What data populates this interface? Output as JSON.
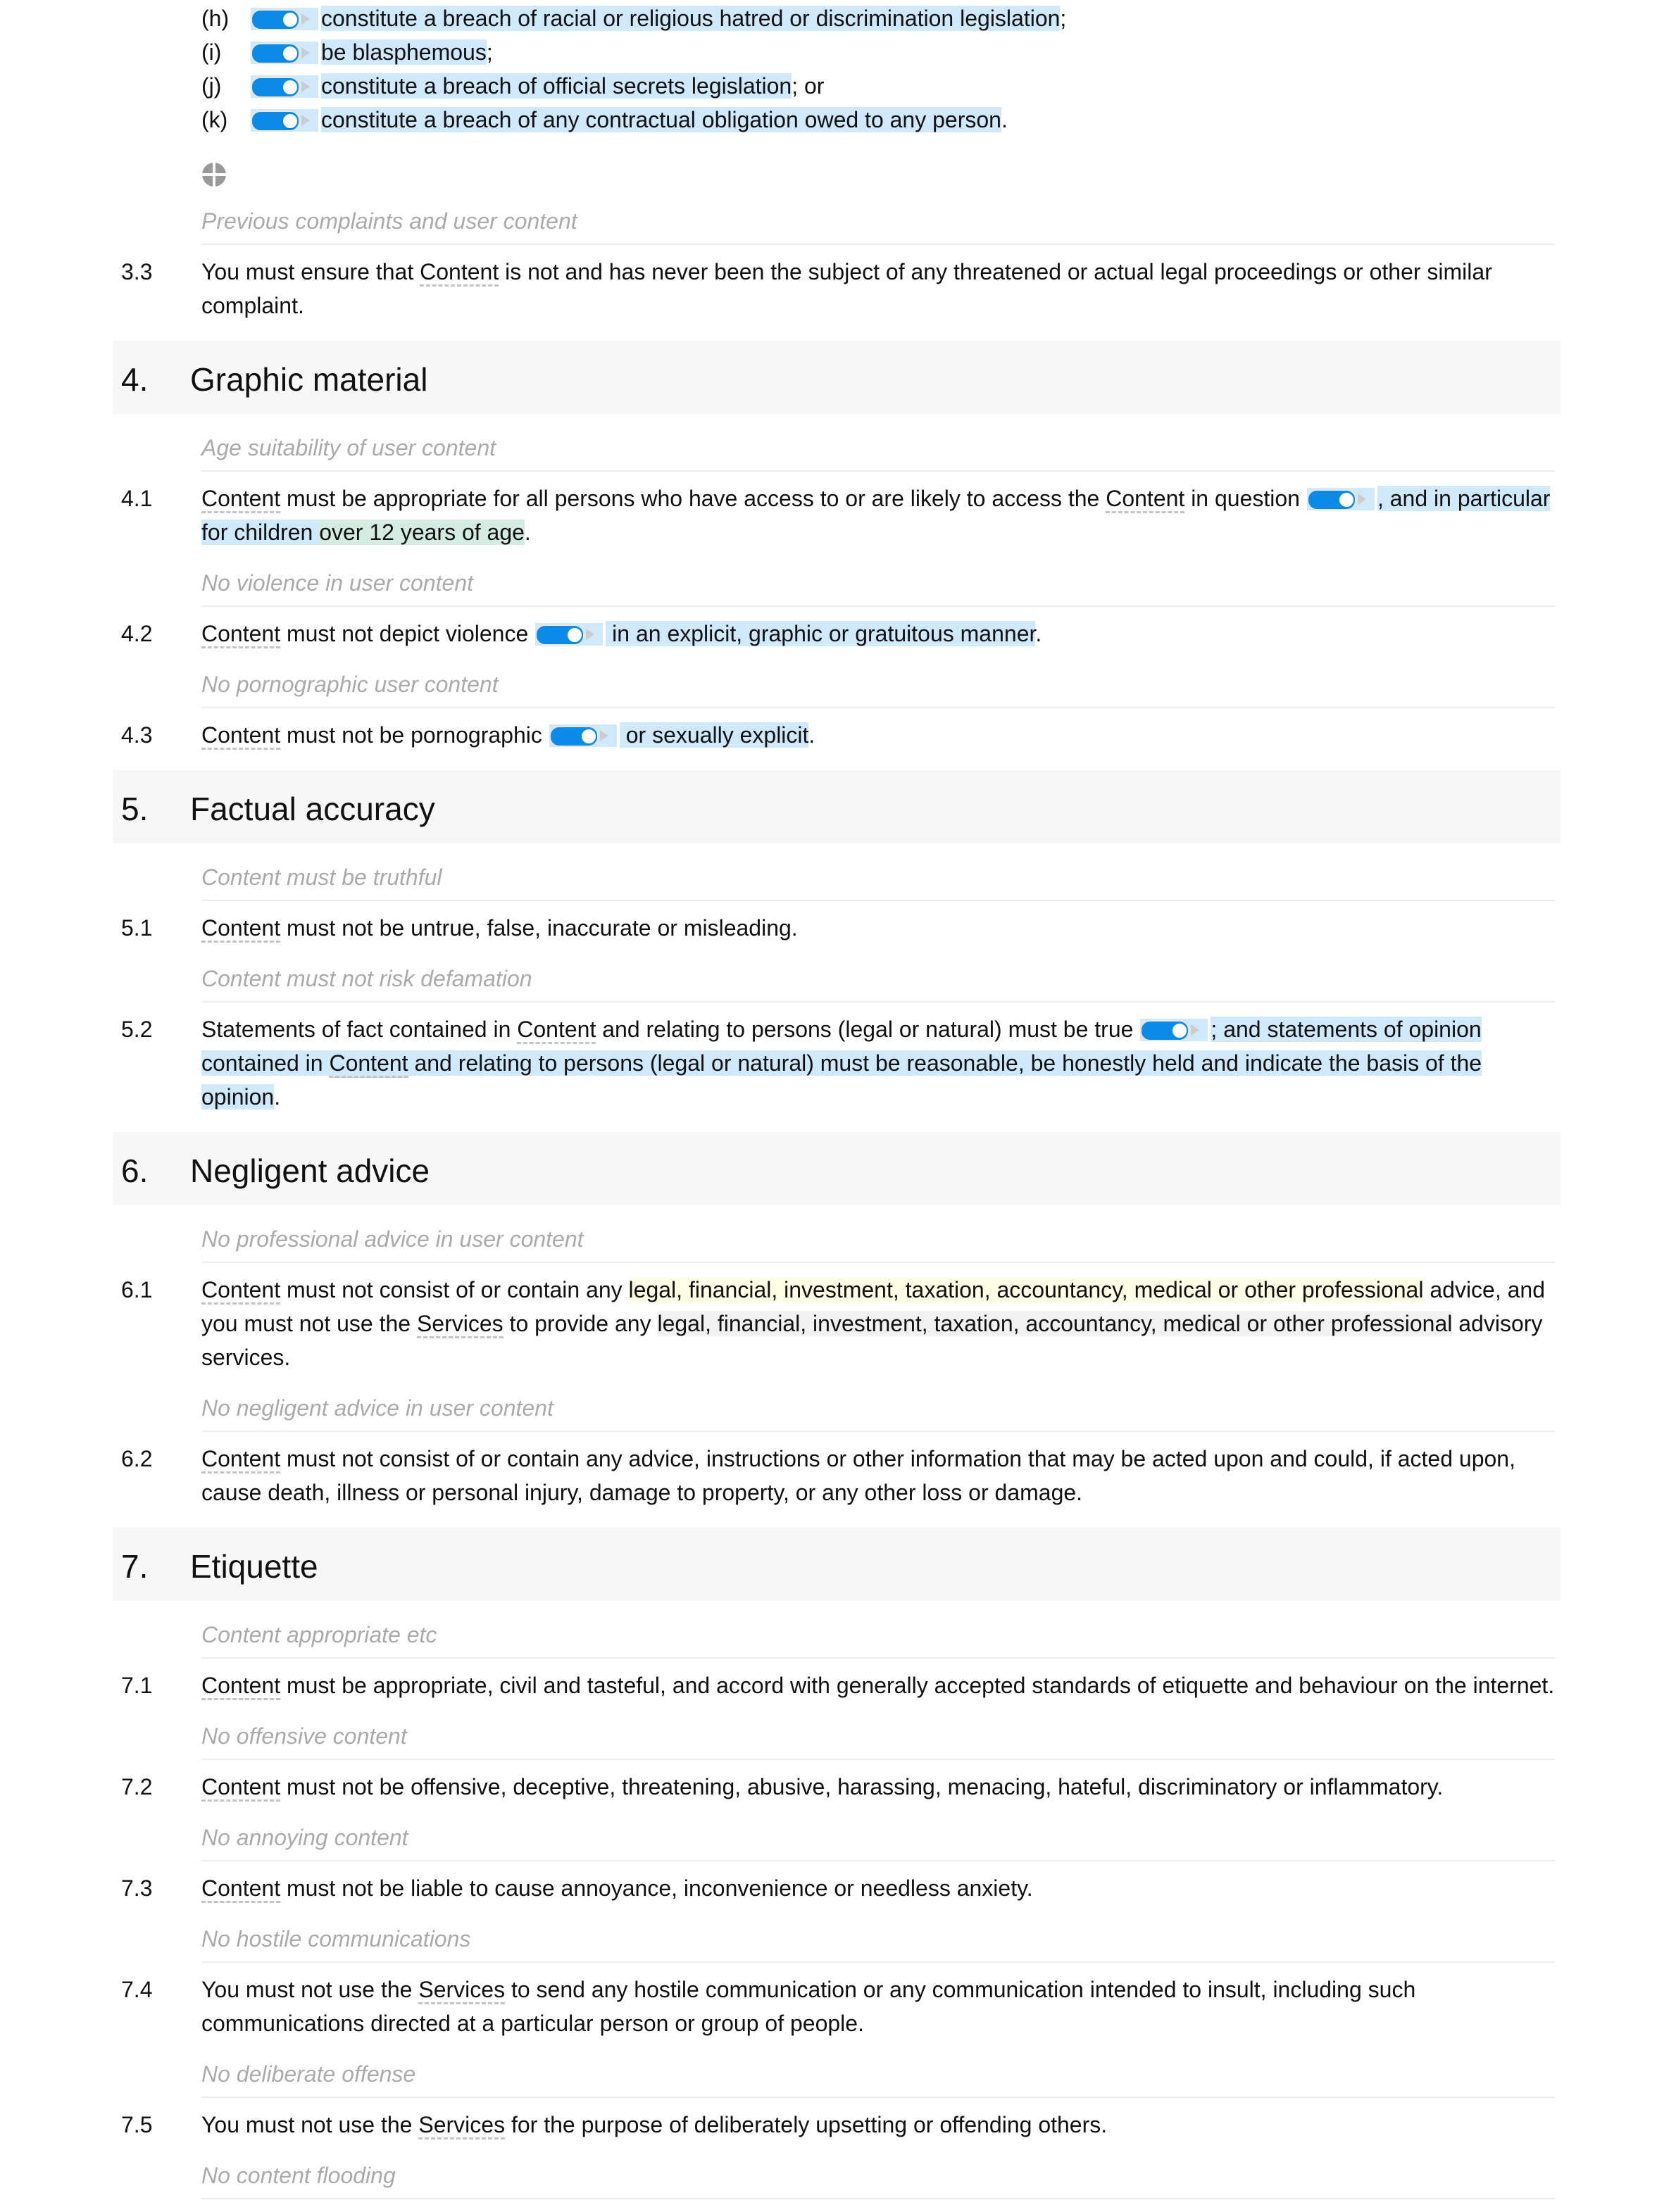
{
  "colors": {
    "highlight_blue": "#cfe8fa",
    "highlight_green": "#d3ebe1",
    "highlight_yellow": "#fefde5",
    "highlight_gray": "#f1f1f1",
    "toggle": "#0a8be8",
    "subheading": "#aaaaaa"
  },
  "blocks": [
    {
      "type": "list",
      "label": "(h)",
      "segments": [
        {
          "toggle": true,
          "hl": "blue"
        },
        {
          "text": "constitute a breach of racial or religious hatred or discrimination legislation",
          "hl": "blue"
        },
        {
          "text": ";"
        }
      ]
    },
    {
      "type": "list",
      "label": "(i)",
      "segments": [
        {
          "toggle": true,
          "hl": "blue"
        },
        {
          "text": "be blasphemous",
          "hl": "blue"
        },
        {
          "text": ";"
        }
      ]
    },
    {
      "type": "list",
      "label": "(j)",
      "segments": [
        {
          "toggle": true,
          "hl": "blue"
        },
        {
          "text": "constitute a breach of official secrets legislation",
          "hl": "blue"
        },
        {
          "text": "; or"
        }
      ]
    },
    {
      "type": "list",
      "label": "(k)",
      "segments": [
        {
          "toggle": true,
          "hl": "blue"
        },
        {
          "text": "constitute a breach of any contractual obligation owed to any person",
          "hl": "blue"
        },
        {
          "text": "."
        }
      ]
    },
    {
      "type": "globe",
      "icon": "globe-icon"
    },
    {
      "type": "sub",
      "text": "Previous complaints and user content"
    },
    {
      "type": "para",
      "num": "3.3",
      "segments": [
        {
          "text": "You must ensure that "
        },
        {
          "text": "Content",
          "term": true
        },
        {
          "text": " is not and has never been the subject of any threatened or actual legal proceedings or other similar complaint."
        }
      ]
    },
    {
      "type": "section",
      "num": "4.",
      "title": "Graphic material"
    },
    {
      "type": "sub",
      "text": "Age suitability of user content"
    },
    {
      "type": "para",
      "num": "4.1",
      "segments": [
        {
          "text": "Content",
          "term": true
        },
        {
          "text": " must be appropriate for all persons who have access to or are likely to access the "
        },
        {
          "text": "Content",
          "term": true
        },
        {
          "text": " in question"
        },
        {
          "toggle": true,
          "hl": "blue"
        },
        {
          "text": ", and in particular for children ",
          "hl": "blue"
        },
        {
          "text": "over 12 years of age",
          "hl": "green"
        },
        {
          "text": "."
        }
      ]
    },
    {
      "type": "sub",
      "text": "No violence in user content"
    },
    {
      "type": "para",
      "num": "4.2",
      "segments": [
        {
          "text": "Content",
          "term": true
        },
        {
          "text": " must not depict violence"
        },
        {
          "toggle": true,
          "hl": "blue"
        },
        {
          "text": " in an explicit, graphic or gratuitous manner",
          "hl": "blue"
        },
        {
          "text": "."
        }
      ]
    },
    {
      "type": "sub",
      "text": "No pornographic user content"
    },
    {
      "type": "para",
      "num": "4.3",
      "segments": [
        {
          "text": "Content",
          "term": true
        },
        {
          "text": " must not be pornographic"
        },
        {
          "toggle": true,
          "hl": "blue"
        },
        {
          "text": " or sexually explicit",
          "hl": "blue"
        },
        {
          "text": "."
        }
      ]
    },
    {
      "type": "section",
      "num": "5.",
      "title": "Factual accuracy"
    },
    {
      "type": "sub",
      "text": "Content must be truthful"
    },
    {
      "type": "para",
      "num": "5.1",
      "segments": [
        {
          "text": "Content",
          "term": true
        },
        {
          "text": " must not be untrue, false, inaccurate or misleading."
        }
      ]
    },
    {
      "type": "sub",
      "text": "Content must not risk defamation"
    },
    {
      "type": "para",
      "num": "5.2",
      "segments": [
        {
          "text": "Statements of fact contained in "
        },
        {
          "text": "Content",
          "term": true
        },
        {
          "text": " and relating to persons (legal or natural) must be true"
        },
        {
          "toggle": true,
          "hl": "blue"
        },
        {
          "text": "; and statements of opinion contained in ",
          "hl": "blue"
        },
        {
          "text": "Content",
          "term": true,
          "hl": "blue"
        },
        {
          "text": " and relating to persons (legal or natural) must be reasonable, be honestly held and indicate the basis of the opinion",
          "hl": "blue"
        },
        {
          "text": "."
        }
      ]
    },
    {
      "type": "section",
      "num": "6.",
      "title": "Negligent advice"
    },
    {
      "type": "sub",
      "text": "No professional advice in user content"
    },
    {
      "type": "para",
      "num": "6.1",
      "segments": [
        {
          "text": "Content",
          "term": true
        },
        {
          "text": " must not consist of or contain any "
        },
        {
          "text": "legal, financial, investment, taxation, accountancy, medical or other professional",
          "hl": "yellow"
        },
        {
          "text": " advice, and you must not use the "
        },
        {
          "text": "Services",
          "term": true
        },
        {
          "text": " to provide any "
        },
        {
          "text": "legal, financial, investment, taxation, accountancy, medical or other professional",
          "hl": "gray"
        },
        {
          "text": " advisory services."
        }
      ]
    },
    {
      "type": "sub",
      "text": "No negligent advice in user content"
    },
    {
      "type": "para",
      "num": "6.2",
      "segments": [
        {
          "text": "Content",
          "term": true
        },
        {
          "text": " must not consist of or contain any advice, instructions or other information that may be acted upon and could, if acted upon, cause death, illness or personal injury, damage to property, or any other loss or damage."
        }
      ]
    },
    {
      "type": "section",
      "num": "7.",
      "title": "Etiquette"
    },
    {
      "type": "sub",
      "text": "Content appropriate etc"
    },
    {
      "type": "para",
      "num": "7.1",
      "segments": [
        {
          "text": "Content",
          "term": true
        },
        {
          "text": " must be appropriate, civil and tasteful, and accord with generally accepted standards of etiquette and behaviour on the internet."
        }
      ]
    },
    {
      "type": "sub",
      "text": "No offensive content"
    },
    {
      "type": "para",
      "num": "7.2",
      "segments": [
        {
          "text": "Content",
          "term": true
        },
        {
          "text": " must not be offensive, deceptive, threatening, abusive, harassing, menacing, hateful, discriminatory or inflammatory."
        }
      ]
    },
    {
      "type": "sub",
      "text": "No annoying content"
    },
    {
      "type": "para",
      "num": "7.3",
      "segments": [
        {
          "text": "Content",
          "term": true
        },
        {
          "text": " must not be liable to cause annoyance, inconvenience or needless anxiety."
        }
      ]
    },
    {
      "type": "sub",
      "text": "No hostile communications"
    },
    {
      "type": "para",
      "num": "7.4",
      "segments": [
        {
          "text": "You must not use the "
        },
        {
          "text": "Services",
          "term": true
        },
        {
          "text": " to send any hostile communication or any communication intended to insult, including such communications directed at a particular person or group of people."
        }
      ]
    },
    {
      "type": "sub",
      "text": "No deliberate offense"
    },
    {
      "type": "para",
      "num": "7.5",
      "segments": [
        {
          "text": "You must not use the "
        },
        {
          "text": "Services",
          "term": true
        },
        {
          "text": " for the purpose of deliberately upsetting or offending others."
        }
      ]
    },
    {
      "type": "sub",
      "text": "No content flooding"
    }
  ]
}
